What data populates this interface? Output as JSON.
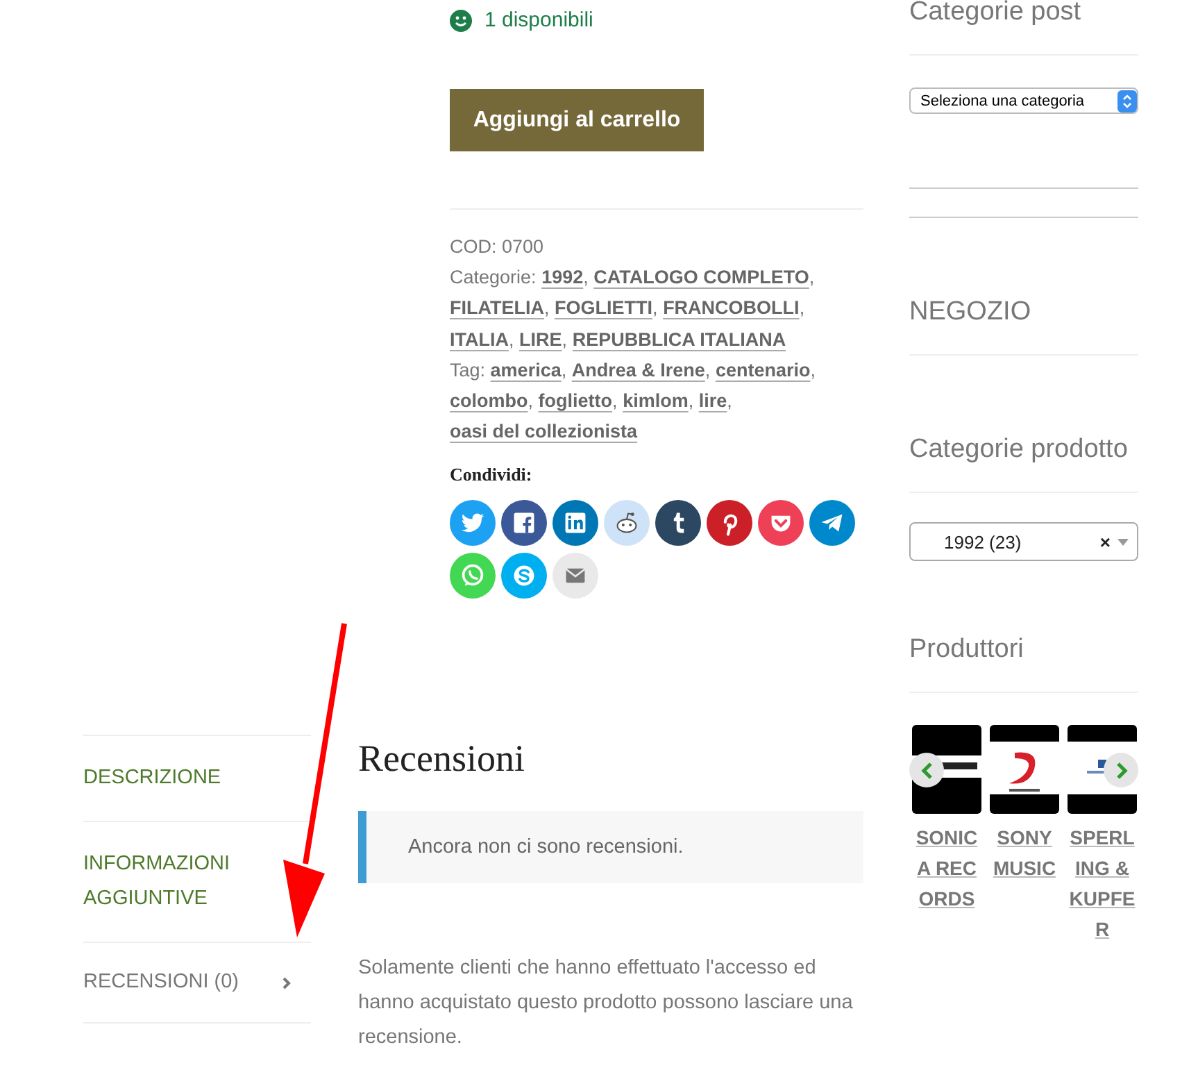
{
  "product": {
    "stock": "1 disponibili",
    "add_to_cart": "Aggiungi al carrello",
    "sku": "COD: 0700",
    "categories_label": "Categorie:",
    "categories": [
      "1992",
      "CATALOGO COMPLETO",
      "FILATELIA",
      "FOGLIETTI",
      "FRANCOBOLLI",
      "ITALIA",
      "LIRE",
      "REPUBBLICA ITALIANA"
    ],
    "separator": ",",
    "tags_label": "Tag:",
    "tags": [
      "america",
      "Andrea & Irene",
      "centenario",
      "colombo",
      "foglietto",
      "kimlom",
      "lire",
      "oasi del collezionista"
    ],
    "share_label": "Condividi:",
    "share_buttons": [
      {
        "kind": "twitter",
        "color": "#1da1f2"
      },
      {
        "kind": "facebook",
        "color": "#3b5998"
      },
      {
        "kind": "linkedin",
        "color": "#0077b5"
      },
      {
        "kind": "reddit",
        "color": "#cee3f8"
      },
      {
        "kind": "tumblr",
        "color": "#2c4762"
      },
      {
        "kind": "pinterest",
        "color": "#cb2027"
      },
      {
        "kind": "pocket",
        "color": "#ee4056"
      },
      {
        "kind": "telegram",
        "color": "#0088cc"
      },
      {
        "kind": "whatsapp",
        "color": "#43d854"
      },
      {
        "kind": "skype",
        "color": "#00aff0"
      },
      {
        "kind": "email",
        "color": "#e9e9e9"
      }
    ]
  },
  "tabs": [
    {
      "label": "DESCRIZIONE",
      "selected": false
    },
    {
      "label": "INFORMAZIONI AGGIUNTIVE",
      "selected": false
    },
    {
      "label": "RECENSIONI (0)",
      "selected": true
    }
  ],
  "reviews": {
    "title": "Recensioni",
    "notice": "Ancora non ci sono recensioni.",
    "message": "Solamente clienti che hanno effettuato l'accesso ed hanno acquistato questo prodotto possono lasciare una recensione."
  },
  "sidebar": {
    "post_categories": {
      "title": "Categorie post",
      "select": "Seleziona una categoria"
    },
    "shop": {
      "title": "NEGOZIO"
    },
    "product_categories": {
      "title": "Categorie prodotto",
      "select": "1992 (23)",
      "clear": "×"
    },
    "producers": {
      "title": "Produttori",
      "items": [
        {
          "name": "SONICA RECORDS"
        },
        {
          "name": "SONY MUSIC"
        },
        {
          "name": "SPERLING & KUPFER"
        }
      ]
    }
  }
}
